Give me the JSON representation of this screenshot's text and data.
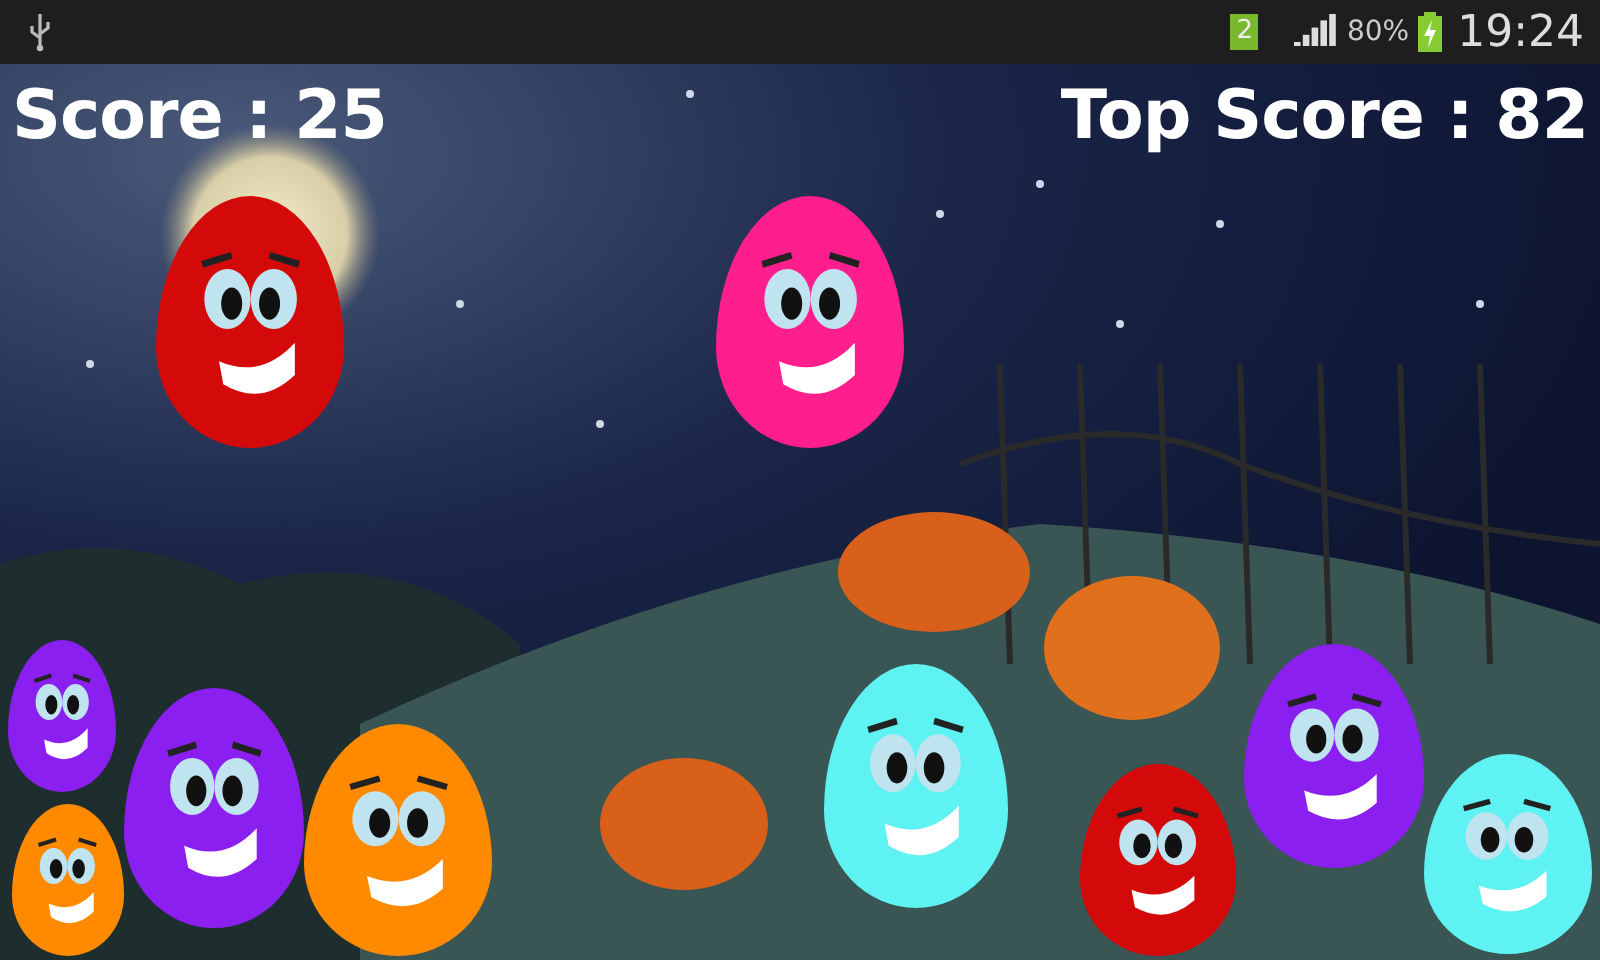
{
  "status_bar": {
    "sim_slot": "2",
    "battery_percent": "80%",
    "time": "19:24"
  },
  "hud": {
    "score": "Score : 25",
    "top_score": "Top Score : 82"
  },
  "eggs": [
    {
      "color": "#d40a0a"
    },
    {
      "color": "#ff1f8c"
    },
    {
      "color": "#8a1ff0"
    },
    {
      "color": "#ff8a00"
    },
    {
      "color": "#5ff2f2"
    },
    {
      "color": "#8a1ff0"
    },
    {
      "color": "#d40a0a"
    },
    {
      "color": "#5ff2f2"
    },
    {
      "color": "#8a1ff0"
    },
    {
      "color": "#ff8a00"
    }
  ]
}
